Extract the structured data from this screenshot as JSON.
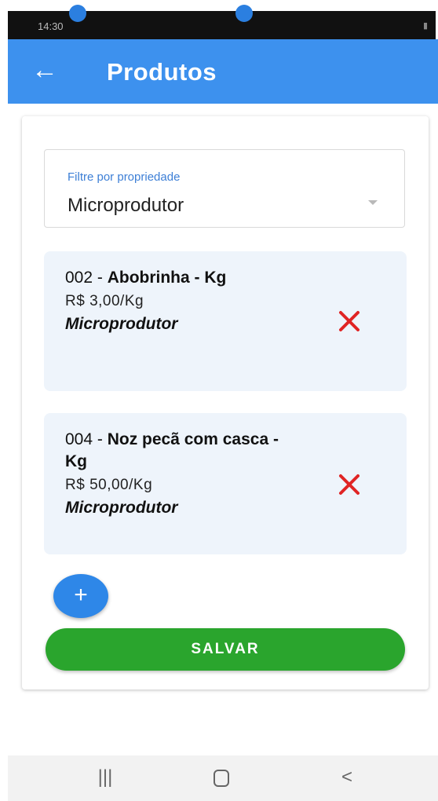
{
  "status_bar": {
    "time": "14:30",
    "icons": [
      "notification-icon",
      "battery-icon",
      "signal-icon"
    ]
  },
  "app_bar": {
    "back_icon": "←",
    "title": "Produtos"
  },
  "filter": {
    "label": "Filtre por propriedade",
    "value": "Microprodutor"
  },
  "products": [
    {
      "code": "002 - ",
      "name": "Abobrinha - Kg",
      "price": "R$ 3,00/Kg",
      "owner": "Microprodutor"
    },
    {
      "code": "004 - ",
      "name": "Noz pecã com casca - Kg",
      "price": "R$ 50,00/Kg",
      "owner": "Microprodutor"
    }
  ],
  "actions": {
    "add": "+",
    "save": "SALVAR"
  },
  "nav_bar": {
    "recent": "|||",
    "back": "<"
  },
  "colors": {
    "app_bar": "#3d91ee",
    "save_button": "#2aa52d",
    "remove_icon": "#e02424",
    "card_background": "#eef4fb"
  }
}
